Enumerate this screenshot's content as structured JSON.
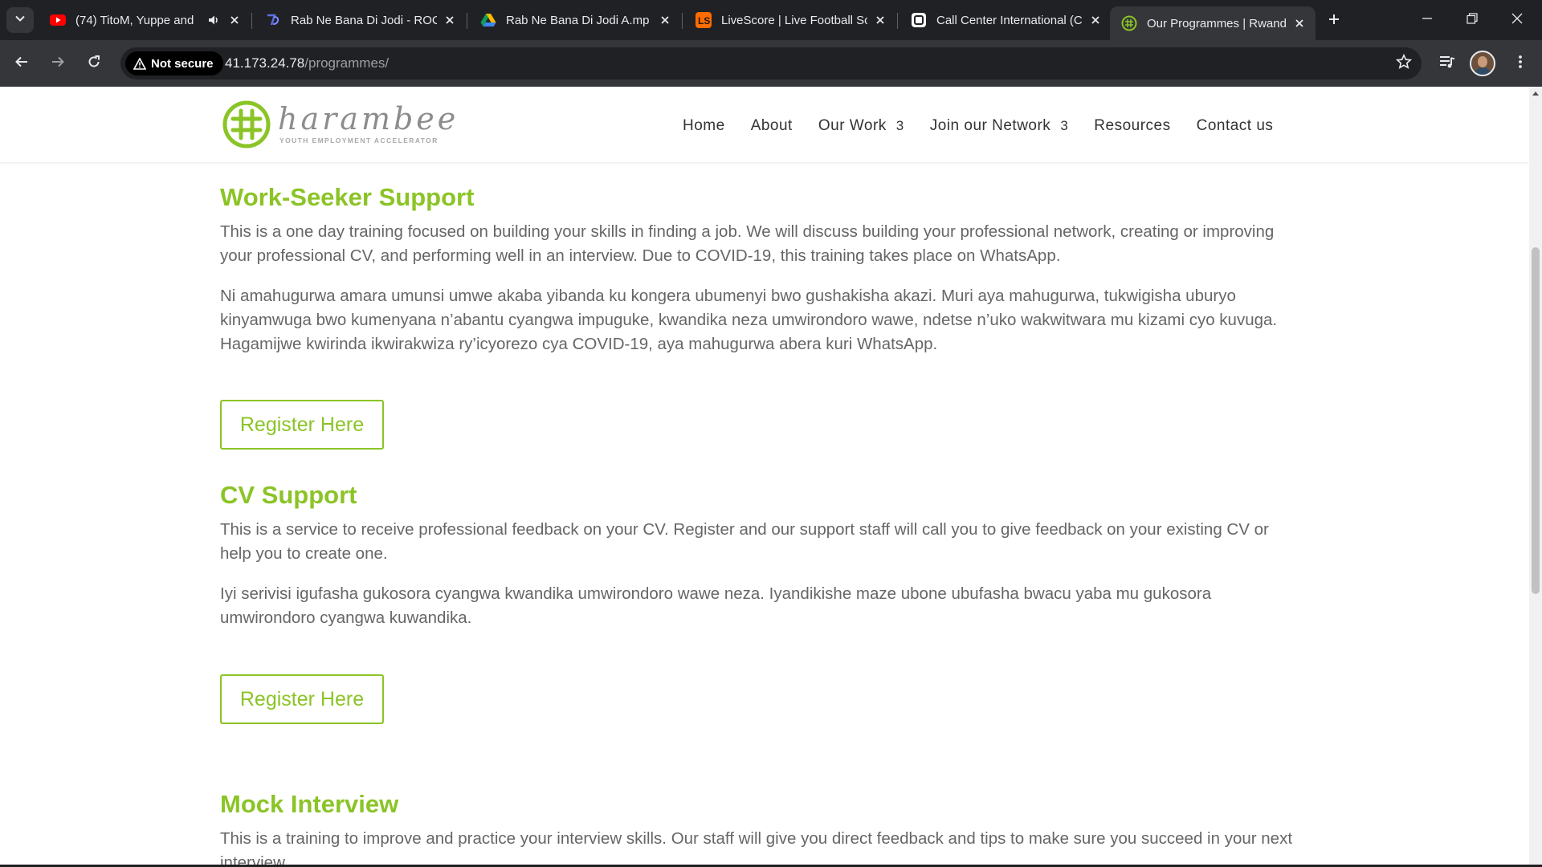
{
  "browser": {
    "tabs": [
      {
        "title": "(74) TitoM, Yuppe and",
        "favicon": "youtube-icon",
        "audio": true,
        "active": false
      },
      {
        "title": "Rab Ne Bana Di Jodi - ROC",
        "favicon": "site-icon",
        "audio": false,
        "active": false
      },
      {
        "title": "Rab Ne Bana Di Jodi A.mp",
        "favicon": "google-drive-icon",
        "audio": false,
        "active": false
      },
      {
        "title": "LiveScore | Live Football Sc",
        "favicon": "livescore-icon",
        "audio": false,
        "active": false
      },
      {
        "title": "Call Center International (C",
        "favicon": "notion-icon",
        "audio": false,
        "active": false
      },
      {
        "title": "Our Programmes | Rwanda",
        "favicon": "harambee-icon",
        "audio": false,
        "active": true
      }
    ],
    "security_label": "Not secure",
    "url_host": "41.173.24.78",
    "url_path": "/programmes/"
  },
  "site": {
    "logo_word": "harambee",
    "logo_tagline": "YOUTH EMPLOYMENT ACCELERATOR",
    "nav": [
      {
        "label": "Home",
        "has_caret": false
      },
      {
        "label": "About",
        "has_caret": false
      },
      {
        "label": "Our Work",
        "has_caret": true
      },
      {
        "label": "Join our Network",
        "has_caret": true
      },
      {
        "label": "Resources",
        "has_caret": false
      },
      {
        "label": "Contact us",
        "has_caret": false
      }
    ],
    "caret_glyph": "3"
  },
  "programmes": [
    {
      "title": "Work-Seeker Support",
      "paragraphs": [
        "This is a one day training focused on building your skills in finding a job. We will discuss building your professional network, creating or improving your professional CV, and performing well in an interview. Due to COVID-19, this training takes place on WhatsApp.",
        "Ni amahugurwa amara umunsi umwe akaba yibanda ku kongera ubumenyi bwo gushakisha akazi. Muri aya mahugurwa, tukwigisha uburyo kinyamwuga bwo kumenyana n’abantu cyangwa impuguke, kwandika neza umwirondoro wawe, ndetse n’uko wakwitwara mu kizami cyo kuvuga. Hagamijwe kwirinda ikwirakwiza ry’icyorezo cya COVID-19, aya mahugurwa abera kuri WhatsApp."
      ],
      "button": "Register Here"
    },
    {
      "title": "CV Support",
      "paragraphs": [
        "This is a service to receive professional feedback on your CV. Register and our support staff will call you to give feedback on your existing CV or help you to create one.",
        "Iyi serivisi igufasha gukosora cyangwa kwandika umwirondoro wawe neza. Iyandikishe maze ubone ubufasha bwacu yaba mu gukosora umwirondoro cyangwa kuwandika."
      ],
      "button": "Register Here"
    },
    {
      "title": "Mock Interview",
      "paragraphs": [
        "This is a training to improve and practice your interview skills. Our staff will give you direct feedback and tips to make sure you succeed in your next interview."
      ]
    }
  ],
  "colors": {
    "accent": "#8bc426",
    "body_text": "#666666",
    "nav_text": "#333333",
    "chrome_dark": "#202124",
    "chrome_mid": "#35363a"
  }
}
